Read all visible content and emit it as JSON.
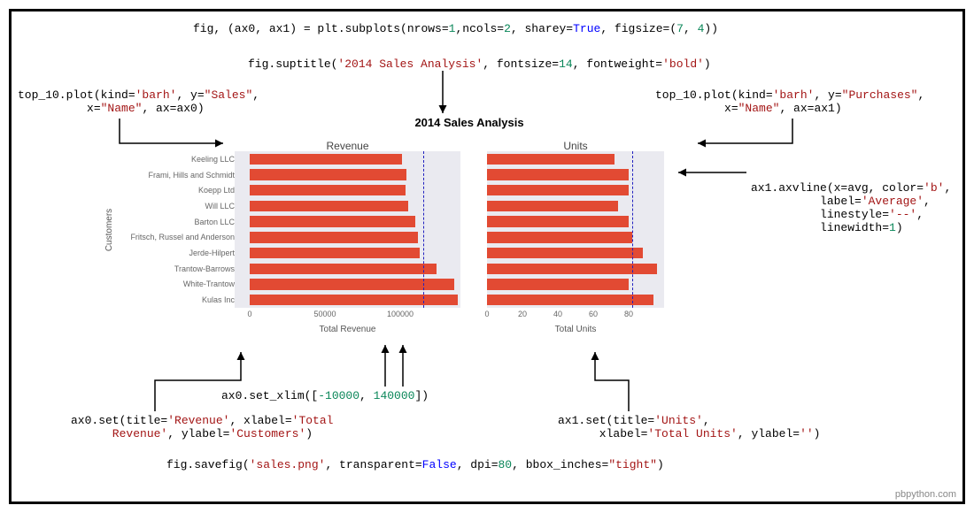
{
  "code_lines": {
    "subplots": "fig, (ax0, ax1) = plt.subplots(nrows=1,ncols=2, sharey=True, figsize=(7, 4))",
    "suptitle": "fig.suptitle('2014 Sales Analysis', fontsize=14, fontweight='bold')",
    "plot_left": "top_10.plot(kind='barh', y=\"Sales\",\n          x=\"Name\", ax=ax0)",
    "plot_right": "top_10.plot(kind='barh', y=\"Purchases\",\n          x=\"Name\", ax=ax1)",
    "axvline": "ax1.axvline(x=avg, color='b',\n          label='Average',\n          linestyle='--',\n          linewidth=1)",
    "xlim": "ax0.set_xlim([-10000, 140000])",
    "ax0_set": "ax0.set(title='Revenue', xlabel='Total\n      Revenue', ylabel='Customers')",
    "ax1_set": "ax1.set(title='Units',\n      xlabel='Total Units', ylabel='')",
    "savefig": "fig.savefig('sales.png', transparent=False, dpi=80, bbox_inches=\"tight\")"
  },
  "watermark": "pbpython.com",
  "chart_data": {
    "suptitle": "2014 Sales Analysis",
    "ylabel": "Customers",
    "categories": [
      "Keeling LLC",
      "Frami, Hills and Schmidt",
      "Koepp Ltd",
      "Will LLC",
      "Barton LLC",
      "Fritsch, Russel and Anderson",
      "Jerde-Hilpert",
      "Trantow-Barrows",
      "White-Trantow",
      "Kulas Inc"
    ],
    "subplots": [
      {
        "type": "barh",
        "title": "Revenue",
        "xlabel": "Total Revenue",
        "xlim": [
          -10000,
          140000
        ],
        "xticks": [
          0,
          50000,
          100000
        ],
        "values": [
          101000,
          104000,
          103500,
          105000,
          110000,
          112000,
          113000,
          124000,
          136000,
          138000
        ],
        "avg_line": 115000
      },
      {
        "type": "barh",
        "title": "Units",
        "xlabel": "Total Units",
        "xlim": [
          0,
          100
        ],
        "xticks": [
          0,
          20,
          40,
          60,
          80
        ],
        "values": [
          72,
          80,
          80,
          74,
          80,
          82,
          88,
          96,
          80,
          94
        ],
        "avg_line": 82
      }
    ]
  }
}
